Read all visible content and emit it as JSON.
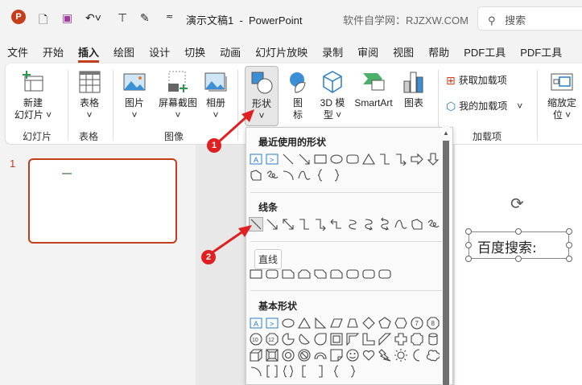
{
  "titlebar": {
    "title": "演示文稿1  -  PowerPoint",
    "site": "软件自学网：RJZXW.COM",
    "search_placeholder": "搜索"
  },
  "tabs": [
    "文件",
    "开始",
    "插入",
    "绘图",
    "设计",
    "切换",
    "动画",
    "幻灯片放映",
    "录制",
    "审阅",
    "视图",
    "帮助",
    "PDF工具",
    "PDF工具"
  ],
  "active_tab": "插入",
  "ribbon": {
    "new_slide": "新建\n幻灯片 ˅",
    "table": "表格",
    "picture": "图片",
    "screenshot": "屏幕截图",
    "album": "相册",
    "shapes": "形状",
    "icons": "图\n标",
    "model3d": "3D 模\n型 ˅",
    "smartart": "SmartArt",
    "chart": "图表",
    "get_addins": "获取加载项",
    "my_addins": "我的加载项",
    "zoom": "缩放定\n位 ˅",
    "groups": {
      "slides": "幻灯片",
      "tables": "表格",
      "images": "图像",
      "addins": "加载项"
    }
  },
  "slide_panel": {
    "number": "1"
  },
  "slide": {
    "textbox": "百度搜索:"
  },
  "menu": {
    "recent": "最近使用的形状",
    "lines": "线条",
    "basic": "基本形状",
    "tooltip": "直线",
    "recent_shapes": [
      [
        "textbox",
        "vtextbox",
        "line",
        "arrow",
        "rect",
        "oval",
        "roundrect",
        "triangle",
        "elbow",
        "elbowarrow",
        "rightarrow",
        "downarrow"
      ],
      [
        "freeform",
        "scribble",
        "arc",
        "curve",
        "lbrace",
        "rbrace"
      ]
    ],
    "line_shapes": [
      [
        "line",
        "arrow",
        "dblarrow",
        "elbow",
        "elbowarrow",
        "elbowdbl",
        "curved",
        "curvedarrow",
        "curveddbl",
        "curve",
        "freeform",
        "scribble"
      ]
    ],
    "rect_shapes": [
      [
        "rect",
        "roundrect",
        "snip1",
        "snip2",
        "snipdiag",
        "sniproundrect",
        "roundrect",
        "roundrect",
        "roundrect"
      ]
    ],
    "basic_shapes": [
      [
        "textbox",
        "vtextbox",
        "oval",
        "triangle",
        "rtriangle",
        "parallelogram",
        "trapezoid",
        "diamond",
        "pentagon",
        "hexagon",
        "heptagon",
        "octagon"
      ],
      [
        "decagon",
        "dodecagon",
        "pie",
        "chord",
        "teardrop",
        "frame",
        "halfframe",
        "lshape",
        "diagstripe",
        "plus",
        "plaque",
        "can"
      ],
      [
        "cube",
        "bevel",
        "donut",
        "nosymbol",
        "blockarc",
        "foldedcorner",
        "smiley",
        "heart",
        "lightning",
        "sun",
        "moon",
        "cloud"
      ],
      [
        "arc",
        "brackets",
        "braces",
        "lbracket",
        "rbracket",
        "lbrace",
        "rbrace"
      ]
    ]
  },
  "annotations": [
    "1",
    "2"
  ],
  "colors": {
    "accent": "#c43e1c",
    "annotation": "#e02020"
  }
}
